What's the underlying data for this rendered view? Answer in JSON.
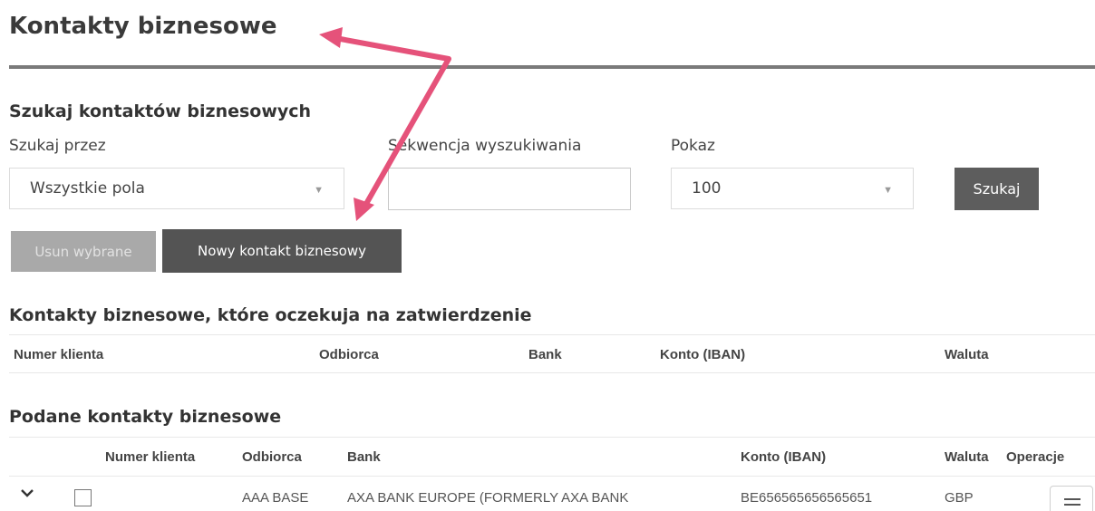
{
  "page": {
    "title": "Kontakty biznesowe"
  },
  "search": {
    "section_title": "Szukaj kontaktów biznesowych",
    "by_label": "Szukaj przez",
    "by_value": "Wszystkie pola",
    "sequence_label": "Sekwencja wyszukiwania",
    "sequence_value": "",
    "show_label": "Pokaz",
    "show_value": "100",
    "search_button": "Szukaj"
  },
  "actions": {
    "delete_selected": "Usun wybrane",
    "new_contact": "Nowy kontakt biznesowy"
  },
  "pending": {
    "section_title": "Kontakty biznesowe, które oczekuja na zatwierdzenie",
    "columns": [
      "Numer klienta",
      "Odbiorca",
      "Bank",
      "Konto (IBAN)",
      "Waluta"
    ]
  },
  "given": {
    "section_title": "Podane kontakty biznesowe",
    "columns": [
      "Numer klienta",
      "Odbiorca",
      "Bank",
      "Konto (IBAN)",
      "Waluta",
      "Operacje"
    ],
    "rows": [
      {
        "client_number": "",
        "recipient": "AAA BASE",
        "bank": "AXA BANK EUROPE (FORMERLY AXA BANK",
        "iban": "BE656565656565651",
        "currency": "GBP"
      }
    ]
  },
  "icons": {
    "dropdown_caret": "chevron-down-icon",
    "expand_row": "chevron-down-icon",
    "operations_menu": "menu-icon"
  },
  "colors": {
    "annotation_arrow": "#e5527a",
    "primary_button": "#545454",
    "disabled_button": "#a9a9a9",
    "rule": "#7a7a7a"
  }
}
